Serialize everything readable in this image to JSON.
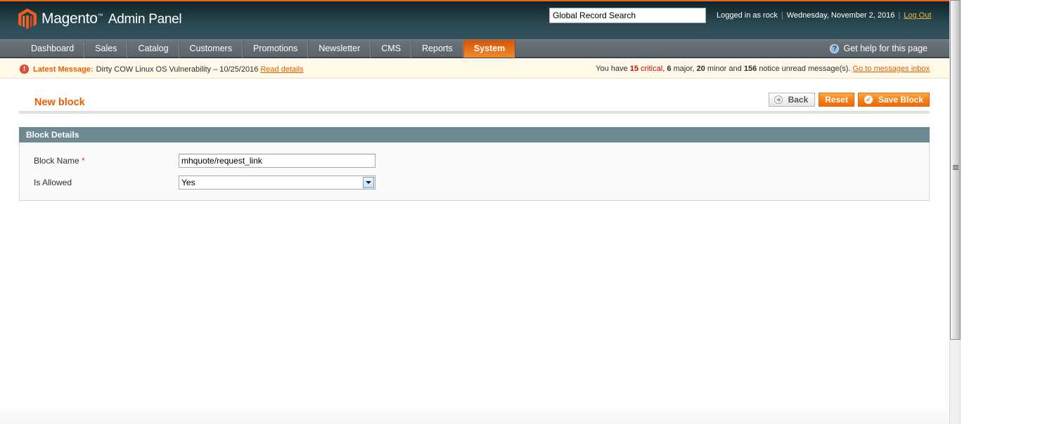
{
  "header": {
    "brand": "Magento",
    "brand_suffix": "Admin Panel",
    "search_value": "Global Record Search",
    "logged_in": "Logged in as rock",
    "date": "Wednesday, November 2, 2016",
    "logout": "Log Out"
  },
  "nav": {
    "items": [
      {
        "label": "Dashboard"
      },
      {
        "label": "Sales"
      },
      {
        "label": "Catalog"
      },
      {
        "label": "Customers"
      },
      {
        "label": "Promotions"
      },
      {
        "label": "Newsletter"
      },
      {
        "label": "CMS"
      },
      {
        "label": "Reports"
      },
      {
        "label": "System",
        "active": true
      }
    ],
    "help": "Get help for this page"
  },
  "notice": {
    "label": "Latest Message:",
    "message": "Dirty COW Linux OS Vulnerability – 10/25/2016",
    "read_details": "Read details",
    "prefix": "You have",
    "critical_count": "15",
    "critical_label": "critical",
    "major_count": "6",
    "major_label": "major,",
    "minor_count": "20",
    "minor_label": "minor and",
    "notice_count": "156",
    "notice_label": "notice unread message(s).",
    "inbox_link": "Go to messages inbox"
  },
  "page": {
    "title": "New block",
    "buttons": {
      "back": "Back",
      "reset": "Reset",
      "save": "Save Block"
    }
  },
  "fieldset": {
    "legend": "Block Details",
    "block_name_label": "Block Name",
    "required_mark": "*",
    "block_name_value": "mhquote/request_link",
    "is_allowed_label": "Is Allowed",
    "is_allowed_value": "Yes"
  },
  "colors": {
    "accent": "#eb5e00",
    "critical": "#d40707",
    "fieldset_header": "#6f8992"
  }
}
